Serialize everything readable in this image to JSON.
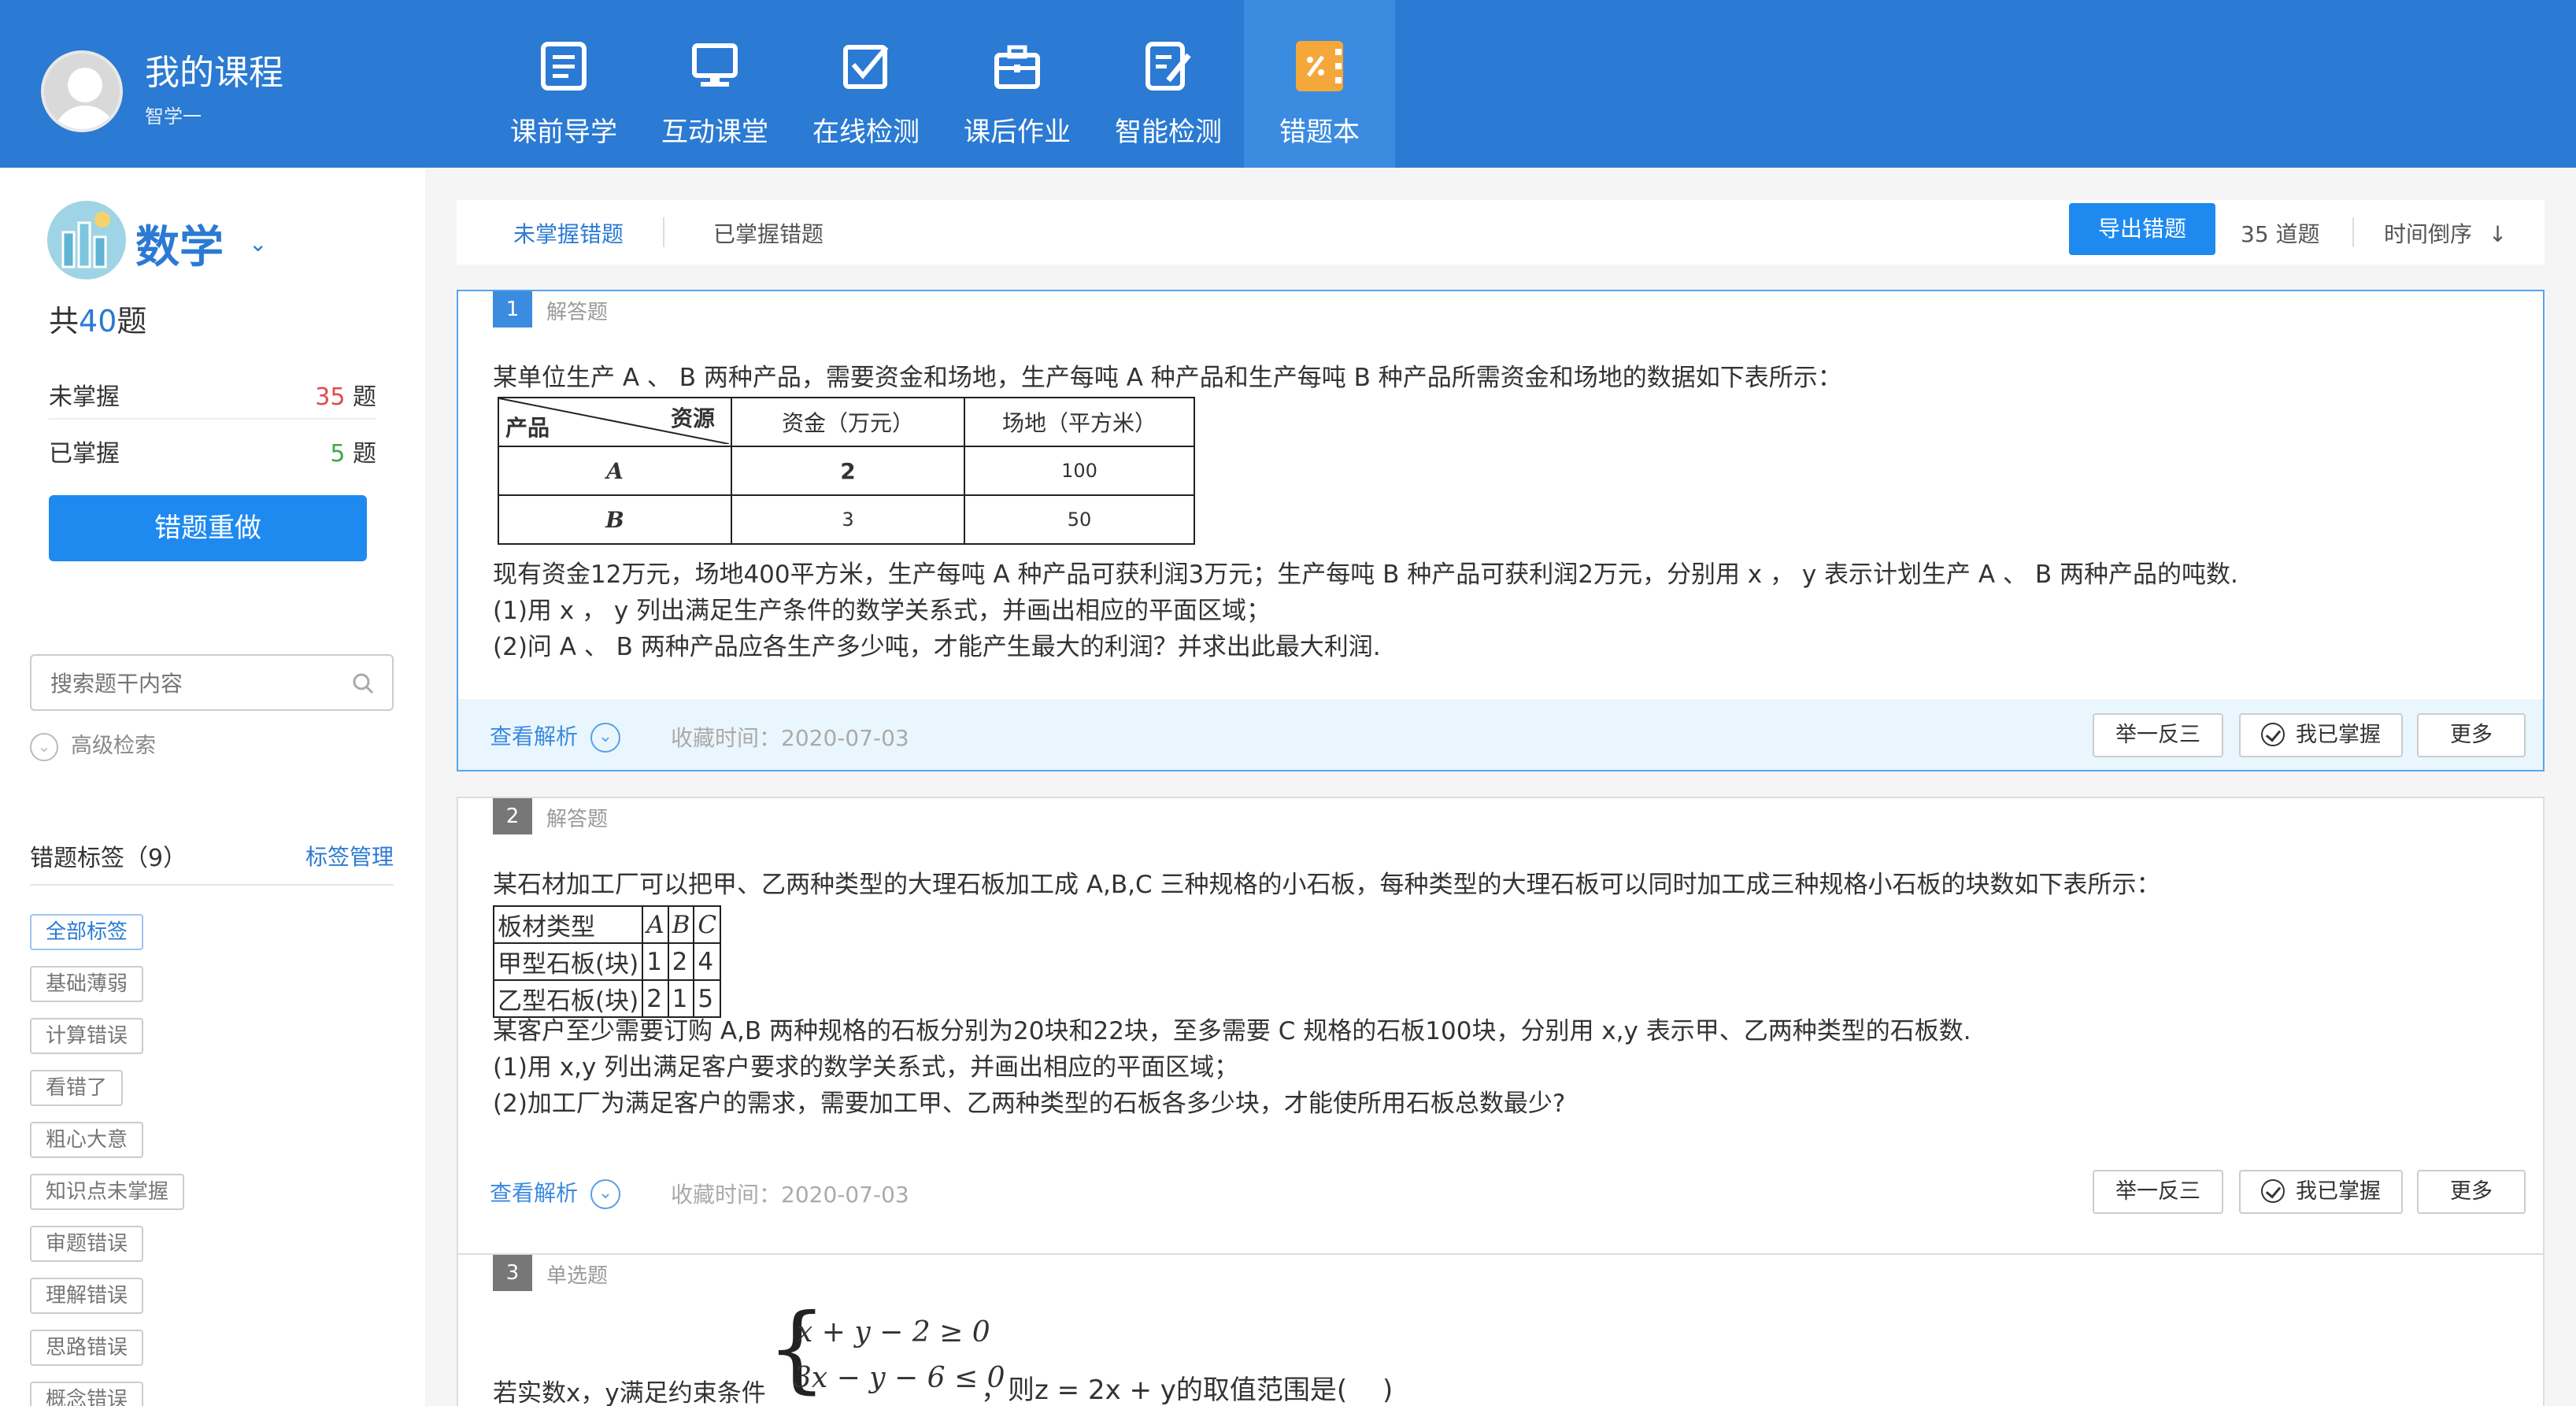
{
  "header": {
    "title": "我的课程",
    "subtitle": "智学一",
    "nav": [
      {
        "label": "课前导学",
        "icon": "document-list-icon"
      },
      {
        "label": "互动课堂",
        "icon": "monitor-icon"
      },
      {
        "label": "在线检测",
        "icon": "checkbox-icon"
      },
      {
        "label": "课后作业",
        "icon": "briefcase-icon"
      },
      {
        "label": "智能检测",
        "icon": "edit-document-icon"
      },
      {
        "label": "错题本",
        "icon": "notebook-icon",
        "active": true
      }
    ],
    "accent_color": "#2b7ad3",
    "active_icon_color": "#f5a83a"
  },
  "sidebar": {
    "subject": "数学",
    "total_prefix": "共",
    "total_count": "40",
    "total_suffix": "题",
    "unmastered_label": "未掌握",
    "unmastered_count": "35",
    "mastered_label": "已掌握",
    "mastered_count": "5",
    "count_unit": "题",
    "redo_button": "错题重做",
    "search_placeholder": "搜索题干内容",
    "advanced_search": "高级检索",
    "tags_title": "错题标签（9）",
    "tags_manage": "标签管理",
    "tags": [
      "全部标签",
      "基础薄弱",
      "计算错误",
      "看错了",
      "粗心大意",
      "知识点未掌握",
      "审题错误",
      "理解错误",
      "思路错误",
      "概念错误"
    ]
  },
  "toolbar": {
    "tab_unmastered": "未掌握错题",
    "tab_mastered": "已掌握错题",
    "export_button": "导出错题",
    "count_label": "35 道题",
    "sort_label": "时间倒序",
    "sort_icon": "arrow-down-icon"
  },
  "questions": [
    {
      "number": "1",
      "type": "解答题",
      "stem": "某单位生产 A 、 B 两种产品，需要资金和场地，生产每吨 A 种产品和生产每吨 B 种产品所需资金和场地的数据如下表所示：",
      "table": {
        "corner_top": "资源",
        "corner_bottom": "产品",
        "col1": "资金（万元）",
        "col2": "场地（平方米）",
        "rows": [
          {
            "name": "A",
            "c1": "2",
            "c2": "100"
          },
          {
            "name": "B",
            "c1": "3",
            "c2": "50"
          }
        ]
      },
      "line2": "现有资金12万元，场地400平方米，生产每吨 A 种产品可获利润3万元；生产每吨 B 种产品可获利润2万元，分别用 x ， y 表示计划生产 A 、 B 两种产品的吨数.",
      "line3": "(1)用 x ， y 列出满足生产条件的数学关系式，并画出相应的平面区域；",
      "line4": "(2)问 A 、 B 两种产品应各生产多少吨，才能产生最大的利润？并求出此最大利润.",
      "view_analysis": "查看解析",
      "fav_time": "收藏时间：2020-07-03",
      "btn_similar": "举一反三",
      "btn_mastered": "我已掌握",
      "btn_more": "更多"
    },
    {
      "number": "2",
      "type": "解答题",
      "stem": "某石材加工厂可以把甲、乙两种类型的大理石板加工成 A,B,C 三种规格的小石板，每种类型的大理石板可以同时加工成三种规格小石板的块数如下表所示：",
      "table": {
        "header": [
          "板材类型",
          "A",
          "B",
          "C"
        ],
        "rows": [
          [
            "甲型石板(块)",
            "1",
            "2",
            "4"
          ],
          [
            "乙型石板(块)",
            "2",
            "1",
            "5"
          ]
        ]
      },
      "line2": "某客户至少需要订购 A,B 两种规格的石板分别为20块和22块，至多需要 C 规格的石板100块，分别用 x,y 表示甲、乙两种类型的石板数.",
      "line3": "(1)用 x,y 列出满足客户要求的数学关系式，并画出相应的平面区域；",
      "line4": "(2)加工厂为满足客户的需求，需要加工甲、乙两种类型的石板各多少块，才能使所用石板总数最少?",
      "view_analysis": "查看解析",
      "fav_time": "收藏时间：2020-07-03",
      "btn_similar": "举一反三",
      "btn_mastered": "我已掌握",
      "btn_more": "更多"
    },
    {
      "number": "3",
      "type": "单选题",
      "stem_prefix": "若实数x，y满足约束条件",
      "constraint1": "x + y − 2 ≥ 0",
      "constraint2": "3x − y − 6 ≤ 0",
      "stem_suffix": "，则z = 2x + y的取值范围是(　 )"
    }
  ]
}
